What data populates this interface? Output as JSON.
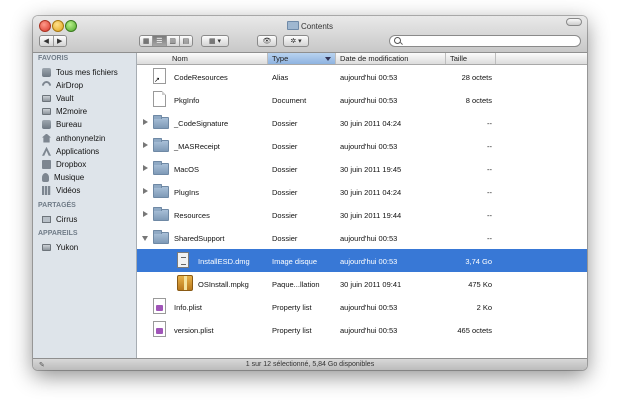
{
  "window": {
    "title": "Contents"
  },
  "toolbar": {
    "nav_back": "◀",
    "nav_forward": "▶",
    "view_modes": [
      "▦",
      "☰",
      "▥",
      "▤"
    ],
    "arrange_label": "▦ ▾",
    "quicklook_label": "👁",
    "action_label": "✲ ▾",
    "search_placeholder": "",
    "search_value": ""
  },
  "sidebar": {
    "sections": [
      {
        "heading": "FAVORIS",
        "items": [
          {
            "label": "Tous mes fichiers",
            "icon": "all-files-icon"
          },
          {
            "label": "AirDrop",
            "icon": "airdrop-icon"
          },
          {
            "label": "Vault",
            "icon": "drive-icon"
          },
          {
            "label": "M2moire",
            "icon": "drive-icon"
          },
          {
            "label": "Bureau",
            "icon": "desktop-icon"
          },
          {
            "label": "anthonynelzin",
            "icon": "home-icon"
          },
          {
            "label": "Applications",
            "icon": "applications-icon"
          },
          {
            "label": "Dropbox",
            "icon": "dropbox-icon"
          },
          {
            "label": "Musique",
            "icon": "music-icon"
          },
          {
            "label": "Vidéos",
            "icon": "movies-icon"
          }
        ]
      },
      {
        "heading": "PARTAGÉS",
        "items": [
          {
            "label": "Cirrus",
            "icon": "network-computer-icon"
          }
        ]
      },
      {
        "heading": "APPAREILS",
        "items": [
          {
            "label": "Yukon",
            "icon": "disk-icon"
          }
        ]
      }
    ]
  },
  "columns": {
    "name": "Nom",
    "type": "Type",
    "date": "Date de modification",
    "size": "Taille"
  },
  "files": [
    {
      "name": "CodeResources",
      "type": "Alias",
      "date": "aujourd'hui 00:53",
      "size": "28 octets",
      "icon": "alias-icon",
      "indent": 0,
      "disclosure": ""
    },
    {
      "name": "PkgInfo",
      "type": "Document",
      "date": "aujourd'hui 00:53",
      "size": "8 octets",
      "icon": "document-icon",
      "indent": 0,
      "disclosure": ""
    },
    {
      "name": "_CodeSignature",
      "type": "Dossier",
      "date": "30 juin 2011 04:24",
      "size": "--",
      "icon": "folder-icon",
      "indent": 0,
      "disclosure": "closed"
    },
    {
      "name": "_MASReceipt",
      "type": "Dossier",
      "date": "aujourd'hui 00:53",
      "size": "--",
      "icon": "folder-icon",
      "indent": 0,
      "disclosure": "closed"
    },
    {
      "name": "MacOS",
      "type": "Dossier",
      "date": "30 juin 2011 19:45",
      "size": "--",
      "icon": "folder-icon",
      "indent": 0,
      "disclosure": "closed"
    },
    {
      "name": "PlugIns",
      "type": "Dossier",
      "date": "30 juin 2011 04:24",
      "size": "--",
      "icon": "folder-icon",
      "indent": 0,
      "disclosure": "closed"
    },
    {
      "name": "Resources",
      "type": "Dossier",
      "date": "30 juin 2011 19:44",
      "size": "--",
      "icon": "folder-icon",
      "indent": 0,
      "disclosure": "closed"
    },
    {
      "name": "SharedSupport",
      "type": "Dossier",
      "date": "aujourd'hui 00:53",
      "size": "--",
      "icon": "folder-icon",
      "indent": 0,
      "disclosure": "open"
    },
    {
      "name": "InstallESD.dmg",
      "type": "Image disque",
      "date": "aujourd'hui 00:53",
      "size": "3,74 Go",
      "icon": "disk-image-icon",
      "indent": 1,
      "disclosure": "",
      "selected": true
    },
    {
      "name": "OSInstall.mpkg",
      "type": "Paque...llation",
      "date": "30 juin 2011 09:41",
      "size": "475 Ko",
      "icon": "package-icon",
      "indent": 1,
      "disclosure": ""
    },
    {
      "name": "Info.plist",
      "type": "Property list",
      "date": "aujourd'hui 00:53",
      "size": "2 Ko",
      "icon": "plist-icon",
      "indent": 0,
      "disclosure": ""
    },
    {
      "name": "version.plist",
      "type": "Property list",
      "date": "aujourd'hui 00:53",
      "size": "465 octets",
      "icon": "plist-icon",
      "indent": 0,
      "disclosure": ""
    }
  ],
  "status": {
    "text": "1 sur 12 sélectionné, 5,84 Go disponibles"
  },
  "colors": {
    "selection": "#3878d6",
    "sidebar": "#dee4ea",
    "sorted_header": "#8eb3e0"
  }
}
